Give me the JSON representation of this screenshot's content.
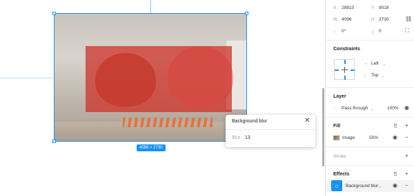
{
  "canvas": {
    "size_badge": "4096 × 2730"
  },
  "popover": {
    "title": "Background blur",
    "close_icon": "close-icon",
    "blur_label": "Blur",
    "blur_value": "13"
  },
  "panel": {
    "position": {
      "x_label": "X",
      "x_value": "28810",
      "y_label": "Y",
      "y_value": "9018",
      "w_label": "W",
      "w_value": "4096",
      "h_label": "H",
      "h_value": "2730",
      "rotation_value": "0°",
      "radius_value": "0"
    },
    "constraints": {
      "title": "Constraints",
      "horizontal": "Left",
      "vertical": "Top"
    },
    "layer": {
      "title": "Layer",
      "blend_mode": "Pass through",
      "opacity": "100%"
    },
    "fill": {
      "title": "Fill",
      "type": "Image",
      "opacity": "50%"
    },
    "stroke": {
      "title": "Stroke"
    },
    "effects": {
      "title": "Effects",
      "item": "Background blur"
    }
  },
  "colors": {
    "accent": "#1692f4",
    "blur_overlay": "#cd2d23"
  }
}
